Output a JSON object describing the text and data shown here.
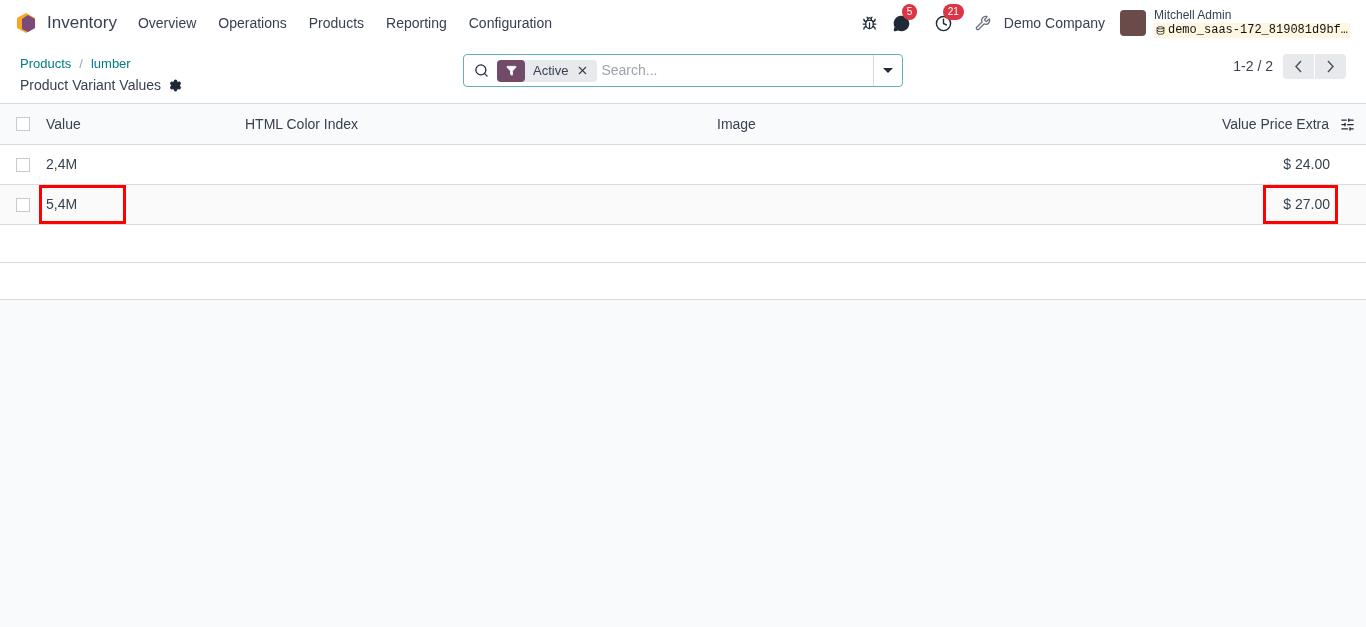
{
  "navbar": {
    "app_name": "Inventory",
    "menu": [
      "Overview",
      "Operations",
      "Products",
      "Reporting",
      "Configuration"
    ],
    "messages_count": "5",
    "activities_count": "21",
    "company": "Demo Company",
    "user": "Mitchell Admin",
    "database": "demo_saas-172_819081d9bf…"
  },
  "breadcrumb": [
    "Products",
    "lumber"
  ],
  "breadcrumb_separator": "/",
  "page_title": "Product Variant Values",
  "search": {
    "facets": [
      {
        "label": "Active"
      }
    ],
    "placeholder": "Search..."
  },
  "pager": "1-2 / 2",
  "table": {
    "all_selected": false,
    "columns": [
      "Value",
      "HTML Color Index",
      "Image",
      "Value Price Extra"
    ],
    "rows": [
      {
        "value": "2,4M",
        "price": "$ 24.00",
        "checked": false,
        "value_highlighted": false,
        "price_highlighted": false
      },
      {
        "value": "5,4M",
        "price": "$ 27.00",
        "checked": false,
        "value_highlighted": true,
        "price_highlighted": true
      }
    ]
  }
}
